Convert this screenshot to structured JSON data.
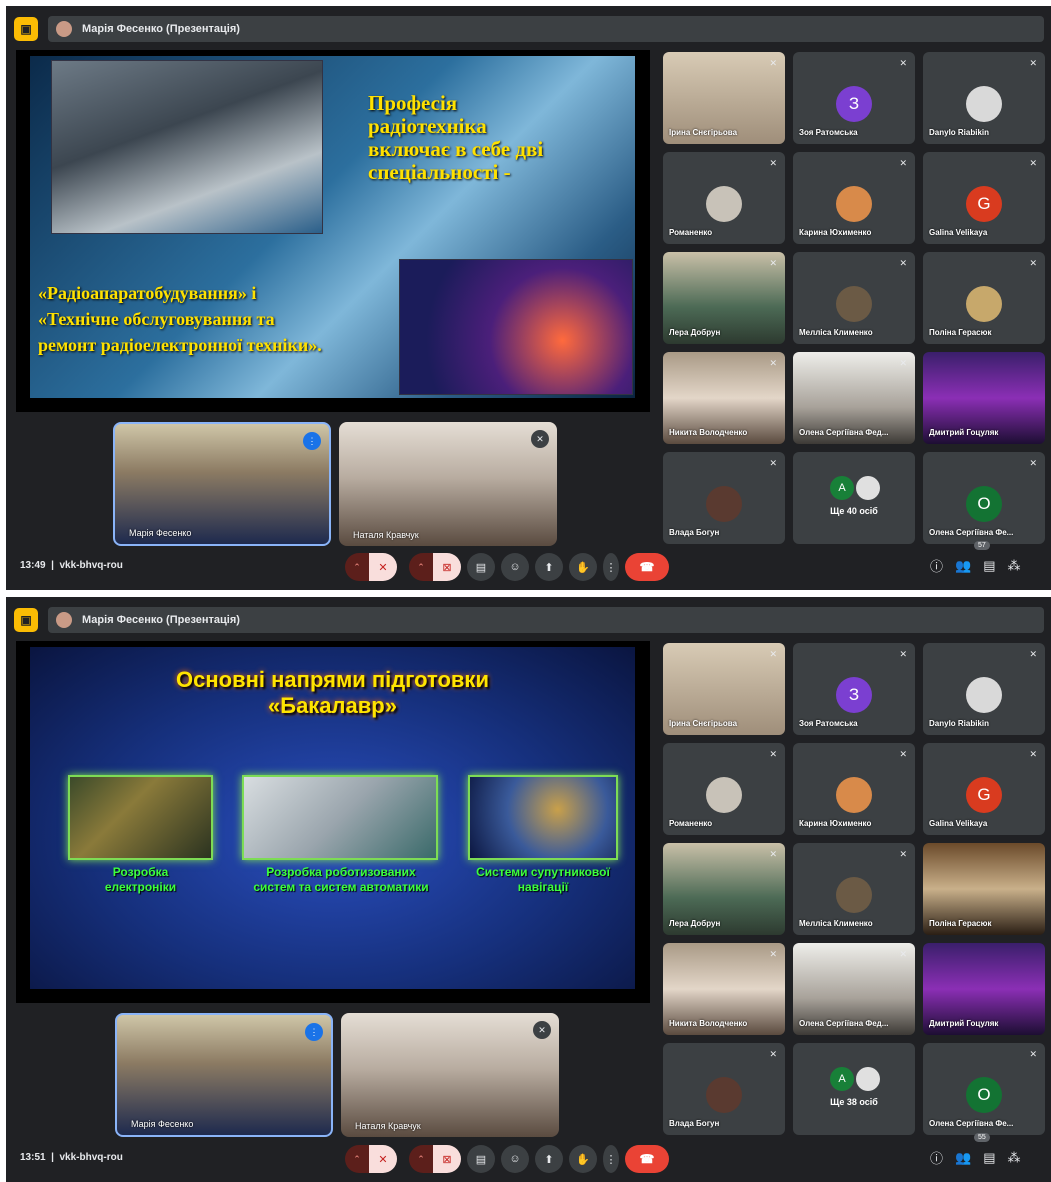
{
  "screens": [
    {
      "presenter": "Марія Фесенко (Презентація)",
      "slide": {
        "title_lines": [
          "Професія",
          "радіотехніка",
          "включає в себе дві",
          "спеціальності -"
        ],
        "sub_lines": [
          "«Радіоапаратобудування» і",
          "«Технічне обслуговування та",
          "ремонт радіоелектронної техніки»."
        ]
      },
      "self_views": [
        "Марія Фесенко",
        "Наталя Кравчук"
      ],
      "participants": [
        "Ірина Снєгірьова",
        "Зоя Ратомська",
        "Danylo Riabikin",
        "Романенко",
        "Карина Юхименко",
        "Galina Velikaya",
        "Лера Добрун",
        "Мелліса Клименко",
        "Поліна Герасюк",
        "Никита Володченко",
        "Олена Сергіївна Фед...",
        "Дмитрий Гоцуляк",
        "Влада Богун",
        "Ще 40 осіб",
        "Олена Сергіївна Фе..."
      ],
      "avatar_letters": {
        "zoya": "З",
        "galina": "G",
        "olena": "О",
        "more": "A"
      },
      "time": "13:49",
      "code": "vkk-bhvq-rou",
      "people_count": "57"
    },
    {
      "presenter": "Марія Фесенко (Презентація)",
      "slide": {
        "title_line1": "Основні напрями підготовки",
        "title_line2": "«Бакалавр»",
        "captions": [
          [
            "Розробка",
            "електроніки"
          ],
          [
            "Розробка роботизованих",
            "систем та систем автоматики"
          ],
          [
            "Системи супутникової",
            "навігації"
          ]
        ]
      },
      "self_views": [
        "Марія Фесенко",
        "Наталя Кравчук"
      ],
      "participants": [
        "Ірина Снєгірьова",
        "Зоя Ратомська",
        "Danylo Riabikin",
        "Романенко",
        "Карина Юхименко",
        "Galina Velikaya",
        "Лера Добрун",
        "Мелліса Клименко",
        "Поліна Герасюк",
        "Никита Володченко",
        "Олена Сергіївна Фед...",
        "Дмитрий Гоцуляк",
        "Влада Богун",
        "Ще 38 осіб",
        "Олена Сергіївна Фе..."
      ],
      "avatar_letters": {
        "zoya": "З",
        "galina": "G",
        "olena": "О",
        "more": "A"
      },
      "time": "13:51",
      "code": "vkk-bhvq-rou",
      "people_count": "55"
    }
  ],
  "colors": {
    "meet_bg": "#202124",
    "tile_bg": "#3c4043",
    "end_call": "#ea4335",
    "accent": "#fbbc04"
  }
}
